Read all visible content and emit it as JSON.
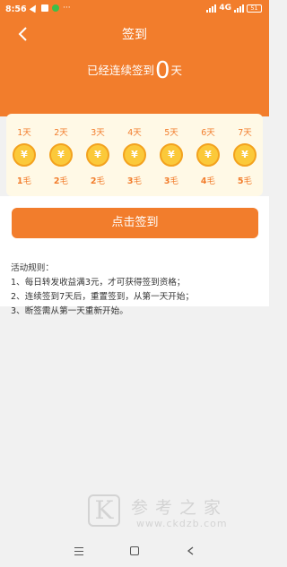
{
  "status_bar": {
    "time": "8:56",
    "dots": "···",
    "network": "4G",
    "battery": "51"
  },
  "header": {
    "title": "签到",
    "streak_prefix": "已经连续签到",
    "streak_days": "0",
    "streak_suffix": "天",
    "background_color": "#f27d2c"
  },
  "checkin": {
    "coin_symbol": "¥",
    "days": [
      {
        "day": "1天",
        "amount": "1",
        "unit": "毛"
      },
      {
        "day": "2天",
        "amount": "2",
        "unit": "毛"
      },
      {
        "day": "3天",
        "amount": "2",
        "unit": "毛"
      },
      {
        "day": "4天",
        "amount": "3",
        "unit": "毛"
      },
      {
        "day": "5天",
        "amount": "3",
        "unit": "毛"
      },
      {
        "day": "6天",
        "amount": "4",
        "unit": "毛"
      },
      {
        "day": "7天",
        "amount": "5",
        "unit": "毛"
      }
    ]
  },
  "signin_button": {
    "label": "点击签到"
  },
  "rules": {
    "title": "活动规则：",
    "items": [
      "1、每日转发收益满3元，才可获得签到资格；",
      "2、连续签到7天后，重置签到，从第一天开始；",
      "3、断签需从第一天重新开始。"
    ]
  },
  "watermark": {
    "logo_letter": "K",
    "chinese_text": "参考之家",
    "url": "www.ckdzb.com"
  },
  "icons": {
    "back": "chevron-left-icon",
    "coin": "coin-icon",
    "menu": "menu-icon",
    "home": "home-icon",
    "nav_back": "back-triangle-icon"
  }
}
